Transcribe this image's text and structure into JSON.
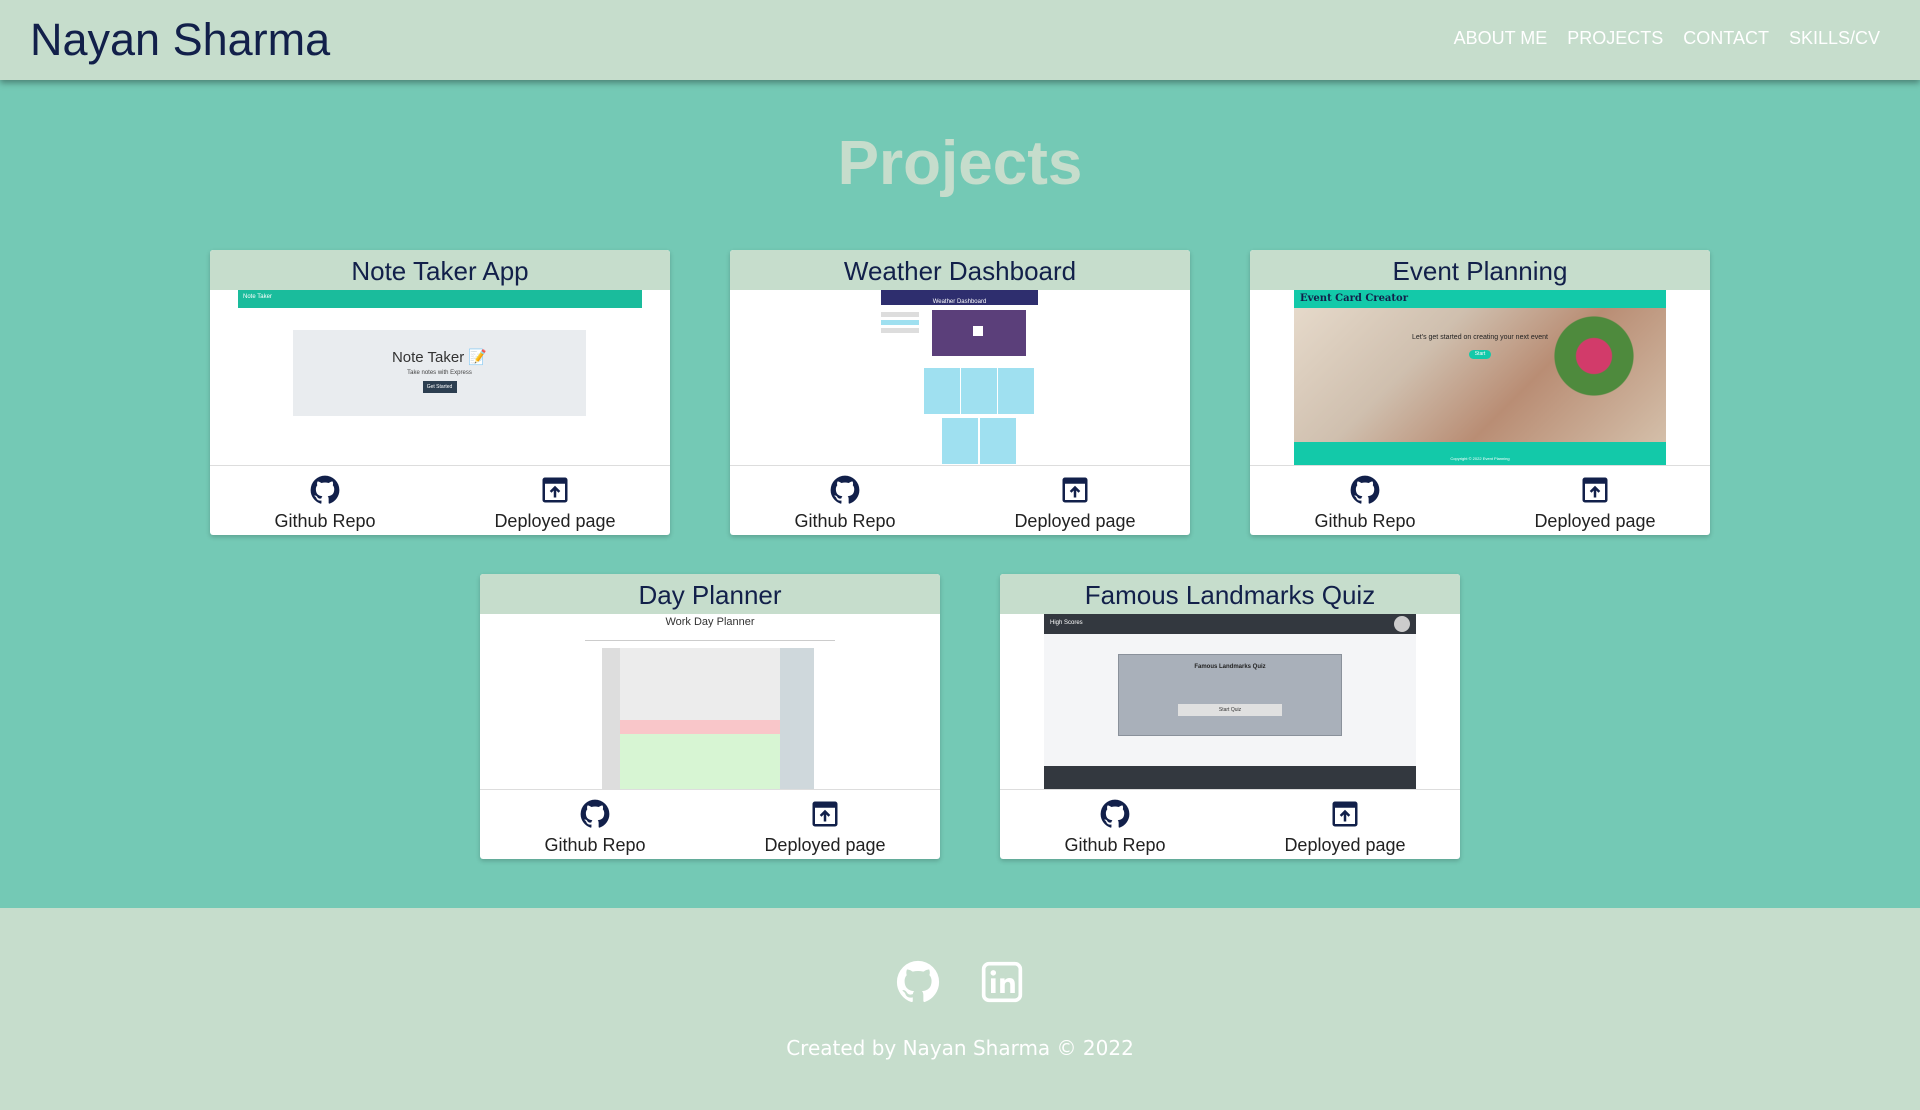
{
  "header": {
    "brand": "Nayan Sharma",
    "nav": [
      "ABOUT ME",
      "PROJECTS",
      "CONTACT",
      "SKILLS/CV"
    ]
  },
  "main": {
    "title": "Projects",
    "projects": [
      {
        "name": "Note Taker App",
        "repo_label": "Github Repo",
        "deploy_label": "Deployed page",
        "shot": {
          "nav": "Note Taker",
          "heading": "Note Taker 📝",
          "sub": "Take notes with Express",
          "button": "Get Started"
        }
      },
      {
        "name": "Weather Dashboard",
        "repo_label": "Github Repo",
        "deploy_label": "Deployed page",
        "shot": {
          "nav": "Weather Dashboard"
        }
      },
      {
        "name": "Event Planning",
        "repo_label": "Github Repo",
        "deploy_label": "Deployed page",
        "shot": {
          "nav": "Event Card Creator",
          "hero": "Let's get started on creating your next event",
          "button": "Start",
          "footer": "Copyright © 2022 Event Planning"
        }
      },
      {
        "name": "Day Planner",
        "repo_label": "Github Repo",
        "deploy_label": "Deployed page",
        "shot": {
          "heading": "Work Day Planner"
        }
      },
      {
        "name": "Famous Landmarks Quiz",
        "repo_label": "Github Repo",
        "deploy_label": "Deployed page",
        "shot": {
          "nav": "High Scores",
          "heading": "Famous Landmarks Quiz",
          "button": "Start Quiz"
        }
      }
    ]
  },
  "footer": {
    "icons": [
      "github-icon",
      "linkedin-icon"
    ],
    "credit": "Created by Nayan Sharma © 2022"
  },
  "colors": {
    "teal": "#74c9b5",
    "mint": "#c6ddcc",
    "navy": "#12204a"
  }
}
